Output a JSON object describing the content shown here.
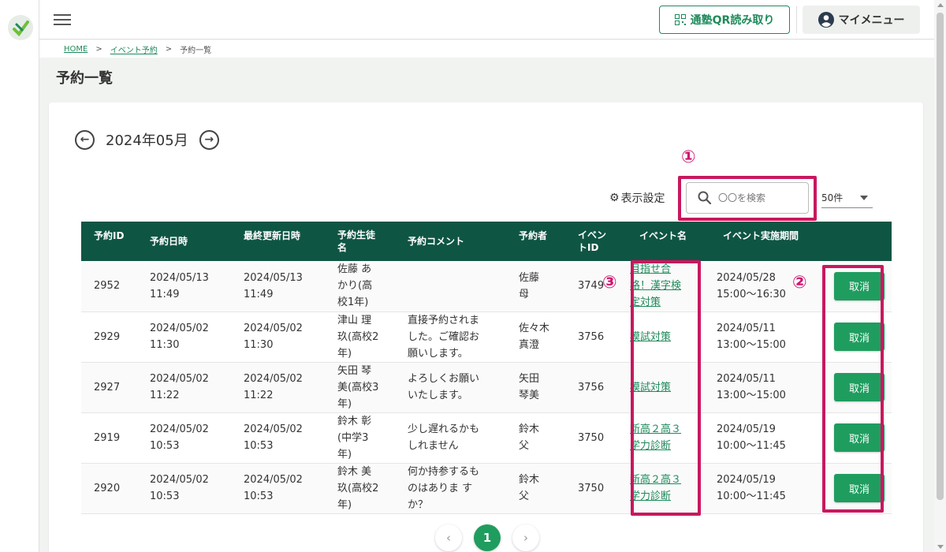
{
  "header": {
    "qr_button_label": "通塾QR読み取り",
    "mymenu_label": "マイメニュー"
  },
  "breadcrumb": {
    "items": [
      "HOME",
      "イベント予約",
      "予約一覧"
    ],
    "separator": ">"
  },
  "page": {
    "title": "予約一覧"
  },
  "month_nav": {
    "current": "2024年05月"
  },
  "toolbar": {
    "display_settings_label": "表示設定",
    "search_placeholder": "〇〇を検索",
    "per_page": "50件"
  },
  "annotations": [
    "①",
    "②",
    "③"
  ],
  "table": {
    "columns": [
      "予約ID",
      "予約日時",
      "最終更新日時",
      "予約生徒名",
      "予約コメント",
      "予約者",
      "イベントID",
      "イベント名",
      "イベント実施期間",
      ""
    ],
    "rows": [
      {
        "id": "2952",
        "reserved": [
          "2024/05/13",
          "11:49"
        ],
        "updated": [
          "2024/05/13",
          "11:49"
        ],
        "student": [
          "佐藤 あ",
          "かり(高",
          "校1年)"
        ],
        "comment": [],
        "booker": [
          "佐藤",
          "母"
        ],
        "event_id": "3749",
        "event_name": [
          "目指せ合",
          "格！漢字検",
          "定対策"
        ],
        "period": [
          "2024/05/28",
          "15:00〜16:30"
        ],
        "action": "取消"
      },
      {
        "id": "2929",
        "reserved": [
          "2024/05/02",
          "11:30"
        ],
        "updated": [
          "2024/05/02",
          "11:30"
        ],
        "student": [
          "津山 理",
          "玖(高校2",
          "年)"
        ],
        "comment": [
          "直接予約されま",
          "した。ご確認お",
          "願いします。"
        ],
        "booker": [
          "佐々木",
          "真澄"
        ],
        "event_id": "3756",
        "event_name": [
          "模試対策"
        ],
        "period": [
          "2024/05/11",
          "13:00〜15:00"
        ],
        "action": "取消"
      },
      {
        "id": "2927",
        "reserved": [
          "2024/05/02",
          "11:22"
        ],
        "updated": [
          "2024/05/02",
          "11:22"
        ],
        "student": [
          "矢田 琴",
          "美(高校3",
          "年)"
        ],
        "comment": [
          "よろしくお願い",
          "いたします。"
        ],
        "booker": [
          "矢田",
          "琴美"
        ],
        "event_id": "3756",
        "event_name": [
          "模試対策"
        ],
        "period": [
          "2024/05/11",
          "13:00〜15:00"
        ],
        "action": "取消"
      },
      {
        "id": "2919",
        "reserved": [
          "2024/05/02",
          "10:53"
        ],
        "updated": [
          "2024/05/02",
          "10:53"
        ],
        "student": [
          "鈴木 彰",
          "(中学3",
          "年)"
        ],
        "comment": [
          "少し遅れるかも",
          "しれません"
        ],
        "booker": [
          "鈴木",
          "父"
        ],
        "event_id": "3750",
        "event_name": [
          "新高２高３",
          "学力診断"
        ],
        "period": [
          "2024/05/19",
          "10:00〜11:45"
        ],
        "action": "取消"
      },
      {
        "id": "2920",
        "reserved": [
          "2024/05/02",
          "10:53"
        ],
        "updated": [
          "2024/05/02",
          "10:53"
        ],
        "student": [
          "鈴木 美",
          "玖(高校2",
          "年)"
        ],
        "comment": [
          "何か持参するも",
          "のはありま す",
          "か？"
        ],
        "booker": [
          "鈴木",
          "父"
        ],
        "event_id": "3750",
        "event_name": [
          "新高２高３",
          "学力診断"
        ],
        "period": [
          "2024/05/19",
          "10:00〜11:45"
        ],
        "action": "取消"
      }
    ]
  },
  "pagination": {
    "current": "1"
  },
  "colors": {
    "brand_green": "#1f9d5f",
    "header_dark_green": "#0f5544",
    "annotation_magenta": "#c8185f"
  }
}
